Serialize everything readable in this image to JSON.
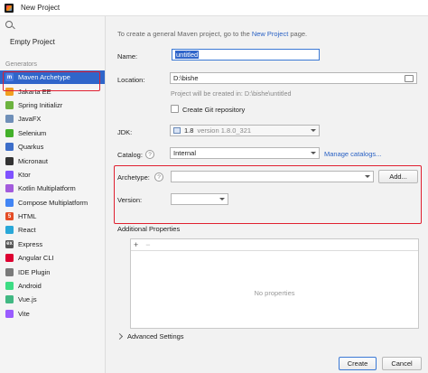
{
  "window": {
    "title": "New Project"
  },
  "sidebar": {
    "empty_project": "Empty Project",
    "generators_header": "Generators",
    "items": [
      {
        "label": "Maven Archetype",
        "icon": "maven-icon",
        "color": "#4a7be0",
        "glyph": "m"
      },
      {
        "label": "Jakarta EE",
        "icon": "jakarta-icon",
        "color": "#f0a020",
        "glyph": ""
      },
      {
        "label": "Spring Initializr",
        "icon": "spring-icon",
        "color": "#6cb33f",
        "glyph": ""
      },
      {
        "label": "JavaFX",
        "icon": "javafx-icon",
        "color": "#6f8fb8",
        "glyph": ""
      },
      {
        "label": "Selenium",
        "icon": "selenium-icon",
        "color": "#43b02a",
        "glyph": ""
      },
      {
        "label": "Quarkus",
        "icon": "quarkus-icon",
        "color": "#3d6ec9",
        "glyph": ""
      },
      {
        "label": "Micronaut",
        "icon": "micronaut-icon",
        "color": "#333333",
        "glyph": ""
      },
      {
        "label": "Ktor",
        "icon": "ktor-icon",
        "color": "#7f52ff",
        "glyph": ""
      },
      {
        "label": "Kotlin Multiplatform",
        "icon": "kotlin-icon",
        "color": "#a35bdc",
        "glyph": ""
      },
      {
        "label": "Compose Multiplatform",
        "icon": "compose-icon",
        "color": "#4285f4",
        "glyph": ""
      },
      {
        "label": "HTML",
        "icon": "html-icon",
        "color": "#e44d26",
        "glyph": "5"
      },
      {
        "label": "React",
        "icon": "react-icon",
        "color": "#2aa8d8",
        "glyph": ""
      },
      {
        "label": "Express",
        "icon": "express-icon",
        "color": "#555555",
        "glyph": "ex"
      },
      {
        "label": "Angular CLI",
        "icon": "angular-icon",
        "color": "#dd0031",
        "glyph": ""
      },
      {
        "label": "IDE Plugin",
        "icon": "ide-plugin-icon",
        "color": "#7a7a7a",
        "glyph": ""
      },
      {
        "label": "Android",
        "icon": "android-icon",
        "color": "#3ddc84",
        "glyph": ""
      },
      {
        "label": "Vue.js",
        "icon": "vue-icon",
        "color": "#41b883",
        "glyph": ""
      },
      {
        "label": "Vite",
        "icon": "vite-icon",
        "color": "#9a5cff",
        "glyph": ""
      }
    ]
  },
  "main": {
    "info_prefix": "To create a general Maven project, go to the ",
    "info_link": "New Project",
    "info_suffix": " page.",
    "name_label": "Name:",
    "name_value": "untitled",
    "location_label": "Location:",
    "location_value": "D:\\bishe",
    "location_hint": "Project will be created in: D:\\bishe\\untitled",
    "git_label": "Create Git repository",
    "jdk_label": "JDK:",
    "jdk_value": "1.8",
    "jdk_version": "version 1.8.0_321",
    "catalog_label": "Catalog:",
    "catalog_value": "Internal",
    "manage_catalogs": "Manage catalogs...",
    "archetype_label": "Archetype:",
    "archetype_value": "",
    "add_button": "Add...",
    "version_label": "Version:",
    "version_value": "",
    "additional_properties": "Additional Properties",
    "add_prop": "+",
    "remove_prop": "−",
    "no_properties": "No properties",
    "advanced_settings": "Advanced Settings",
    "create_button": "Create",
    "cancel_button": "Cancel"
  },
  "colors": {
    "selection": "#2f65ca",
    "accent": "#3b79d5",
    "link": "#2961c4",
    "highlight_outline": "#e02030"
  }
}
